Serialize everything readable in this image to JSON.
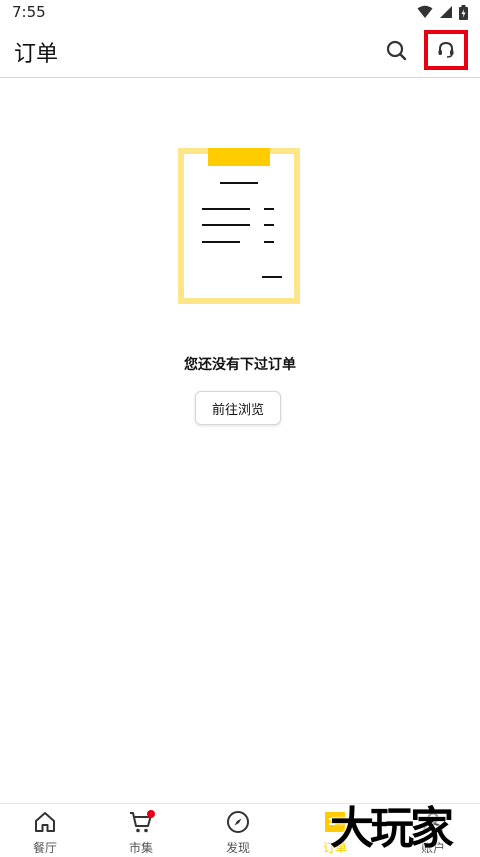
{
  "status_bar": {
    "time": "7:55",
    "icons": [
      "wifi-icon",
      "signal-icon",
      "battery-icon"
    ]
  },
  "header": {
    "title": "订单",
    "search_icon": "search-icon",
    "support_icon": "headset-icon"
  },
  "empty_state": {
    "message": "您还没有下过订单",
    "button_label": "前往浏览",
    "illustration": "clipboard-icon"
  },
  "bottom_nav": {
    "items": [
      {
        "label": "餐厅",
        "icon": "home-icon"
      },
      {
        "label": "市集",
        "icon": "cart-icon",
        "badge": true
      },
      {
        "label": "发现",
        "icon": "compass-icon"
      },
      {
        "label": "订单",
        "icon": "orders-icon",
        "active": true
      },
      {
        "label": "账户",
        "icon": "user-icon"
      }
    ]
  },
  "watermark": "大玩家",
  "colors": {
    "accent": "#ffcc00",
    "highlight_box": "#e60012",
    "clipboard": "#fde68a"
  }
}
